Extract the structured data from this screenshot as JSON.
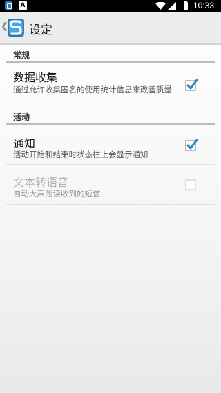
{
  "status_bar": {
    "app_icon_1": "s-app-icon",
    "app_icon_2": "A",
    "time": "10:33"
  },
  "action_bar": {
    "title": "设定",
    "up_icon": "chevron-left-icon",
    "logo_icon": "app-logo-icon"
  },
  "sections": [
    {
      "header": "常规"
    },
    {
      "header": "活动"
    }
  ],
  "prefs": {
    "data_collection": {
      "title": "数据收集",
      "summary": "通过允许收集匿名的使用统计信息来改善质量",
      "checked": true,
      "enabled": true
    },
    "notification": {
      "title": "通知",
      "summary": "活动开始和结束时状态栏上会显示通知",
      "checked": true,
      "enabled": true
    },
    "tts": {
      "title": "文本转语音",
      "summary": "自动大声朗读收到的短信",
      "checked": false,
      "enabled": false
    }
  },
  "colors": {
    "accent": "#1e88c8",
    "checkbox_disabled": "#cfcfcf"
  }
}
